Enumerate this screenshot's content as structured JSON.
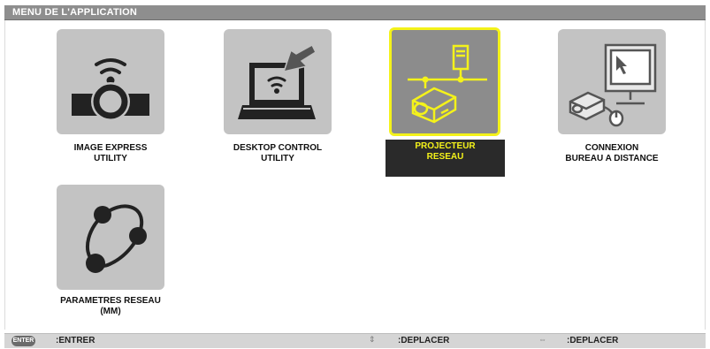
{
  "title": "MENU DE L'APPLICATION",
  "colors": {
    "selected_border": "#f4f21a",
    "selected_label_bg": "#2a2a2a",
    "tile_bg": "#c3c3c3"
  },
  "tiles": [
    {
      "icon": "wireless-projector-icon",
      "line1": "IMAGE EXPRESS",
      "line2": "UTILITY",
      "selected": false
    },
    {
      "icon": "laptop-remote-icon",
      "line1": "DESKTOP CONTROL",
      "line2": "UTILITY",
      "selected": false
    },
    {
      "icon": "network-projector-icon",
      "line1": "PROJECTEUR",
      "line2": "RESEAU",
      "selected": true
    },
    {
      "icon": "remote-desktop-icon",
      "line1": "CONNEXION",
      "line2": "BUREAU A DISTANCE",
      "selected": false
    },
    {
      "icon": "network-settings-icon",
      "line1": "PARAMETRES RESEAU",
      "line2": "(MM)",
      "selected": false
    }
  ],
  "statusbar": {
    "enter_key": "ENTER",
    "enter_label": ":ENTRER",
    "updown_icon": "up-down-arrow-icon",
    "updown_label": ":DEPLACER",
    "leftright_icon": "left-right-arrow-icon",
    "leftright_label": ":DEPLACER"
  }
}
